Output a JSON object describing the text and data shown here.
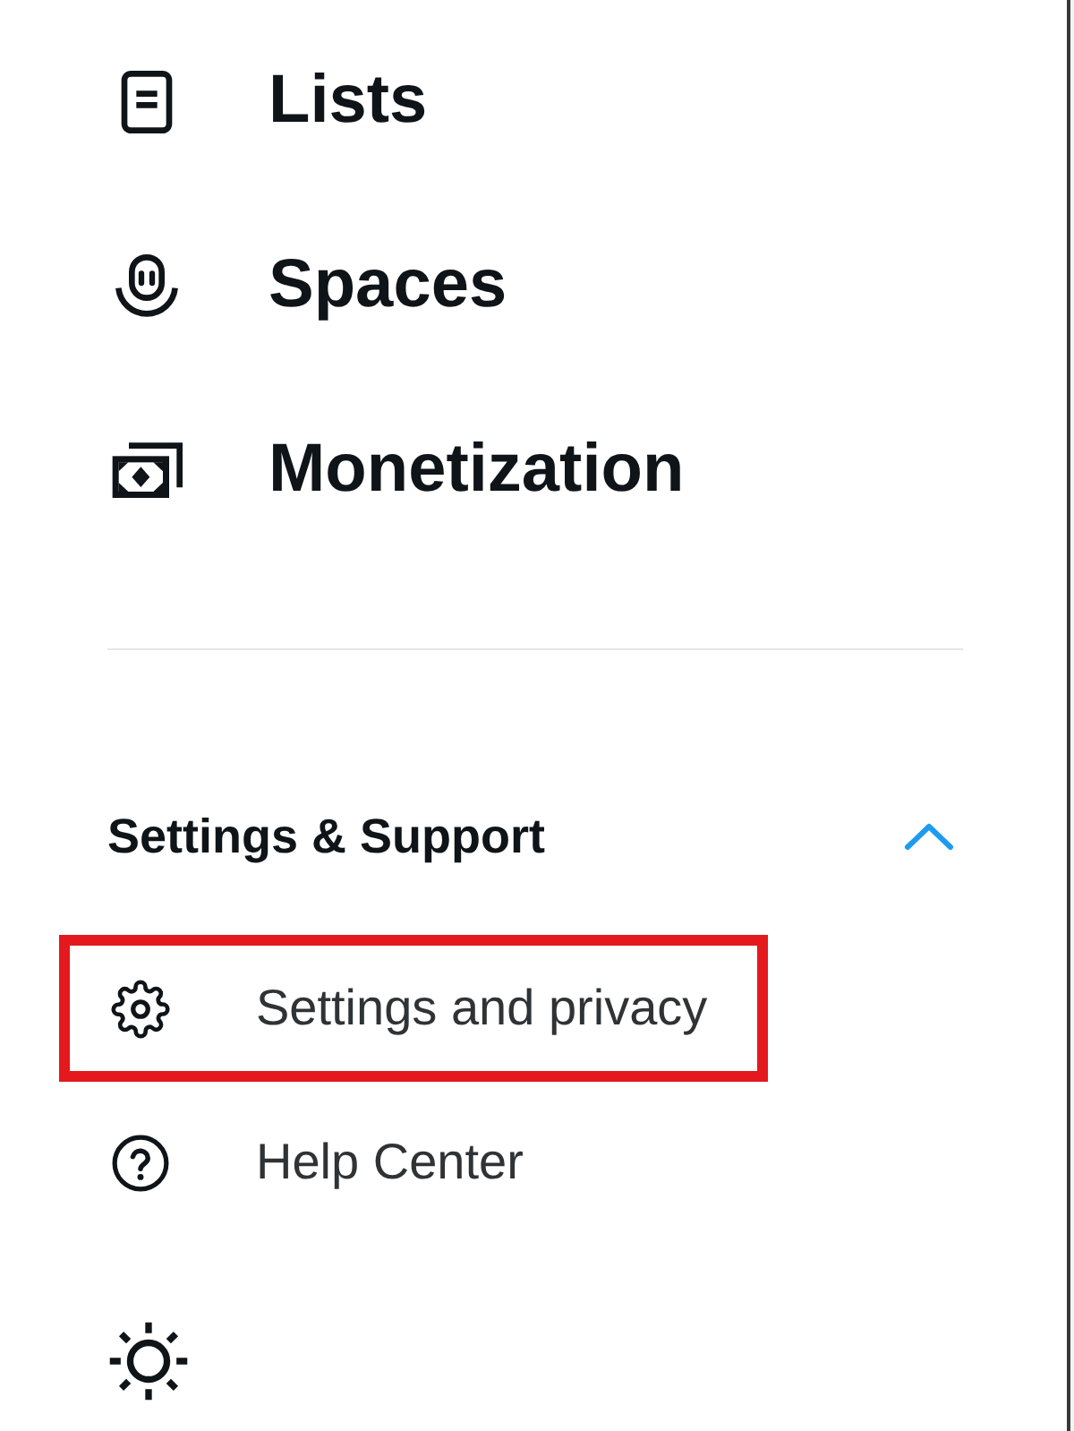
{
  "main_items": [
    {
      "label": "Lists"
    },
    {
      "label": "Spaces"
    },
    {
      "label": "Monetization"
    }
  ],
  "settings_support": {
    "title": "Settings & Support",
    "expanded": true,
    "items": [
      {
        "label": "Settings and privacy",
        "highlighted": true
      },
      {
        "label": "Help Center",
        "highlighted": false
      }
    ]
  }
}
